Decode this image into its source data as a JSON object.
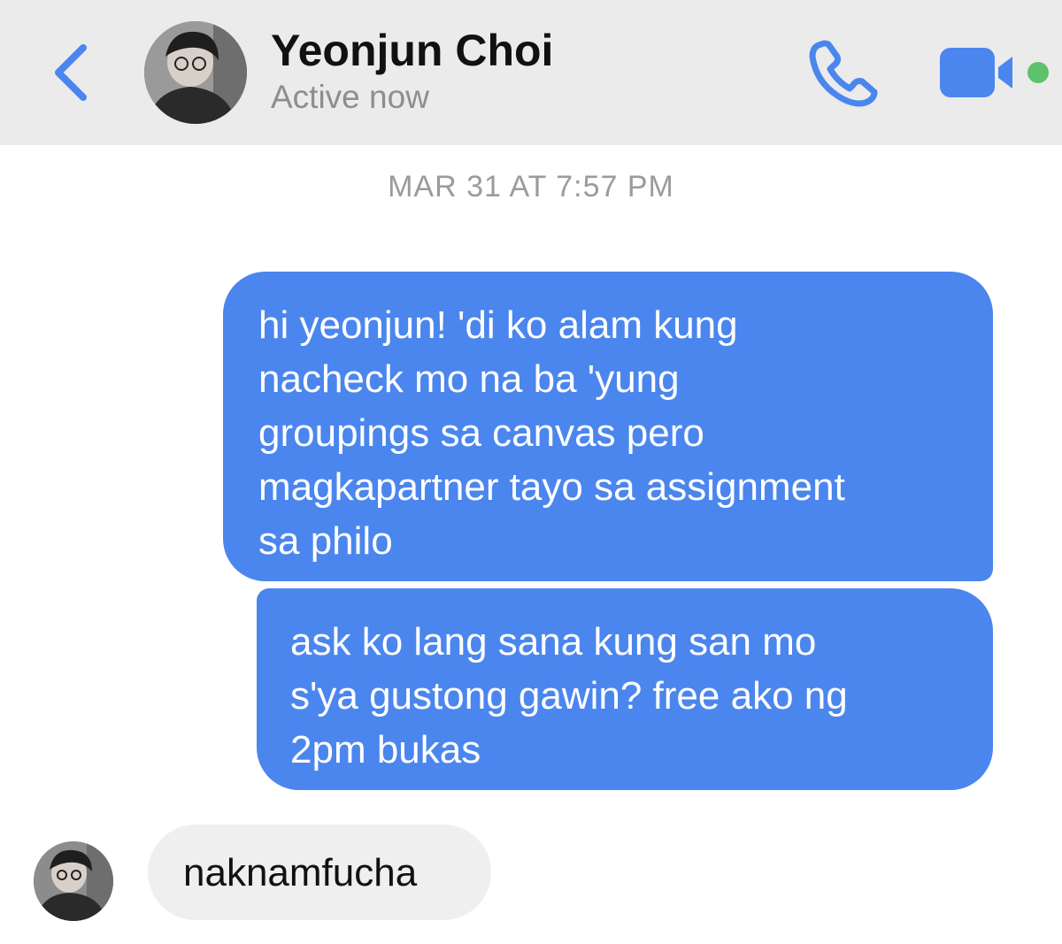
{
  "header": {
    "contact_name": "Yeonjun Choi",
    "status": "Active now",
    "back_icon": "chevron-left-icon",
    "call_icon": "phone-icon",
    "video_icon": "video-camera-icon",
    "accent_color": "#4b86ee",
    "active_dot_color": "#5ec26a"
  },
  "conversation": {
    "timestamp": "MAR 31 AT 7:57 PM",
    "messages": [
      {
        "sender": "me",
        "text": "hi yeonjun! 'di ko alam kung\nnacheck mo na ba 'yung\ngroupings sa canvas pero\nmagkapartner tayo sa assignment\nsa philo"
      },
      {
        "sender": "me",
        "text": "ask ko lang sana kung san mo\ns'ya gustong gawin? free ako ng\n2pm bukas"
      },
      {
        "sender": "contact",
        "text": "naknamfucha"
      }
    ],
    "outgoing_bubble_color": "#4b86ee",
    "incoming_bubble_color": "#efefef"
  }
}
